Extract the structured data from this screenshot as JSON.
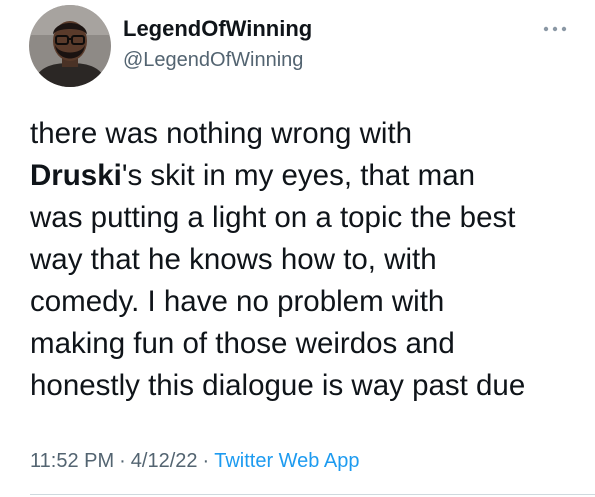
{
  "user": {
    "display_name": "LegendOfWinning",
    "handle": "@LegendOfWinning",
    "avatar_icon": "user-avatar-photo"
  },
  "more_icon": "more-options-icon",
  "tweet": {
    "lines": [
      {
        "text": "there was nothing wrong with"
      },
      {
        "mention": "Druski",
        "text": "'s skit in my eyes, that man"
      },
      {
        "text": "was putting a light on a topic the best"
      },
      {
        "text": "way that he knows how to, with"
      },
      {
        "text": "comedy. I have no problem with"
      },
      {
        "text": "making fun of those weirdos and"
      },
      {
        "text": "honestly this dialogue is way past due"
      }
    ]
  },
  "meta": {
    "time": "11:52 PM",
    "separator": "·",
    "date": "4/12/22",
    "source": "Twitter Web App"
  },
  "colors": {
    "text": "#0f1419",
    "secondary": "#536471",
    "link": "#1d9bf0",
    "divider": "#cfd9de"
  }
}
